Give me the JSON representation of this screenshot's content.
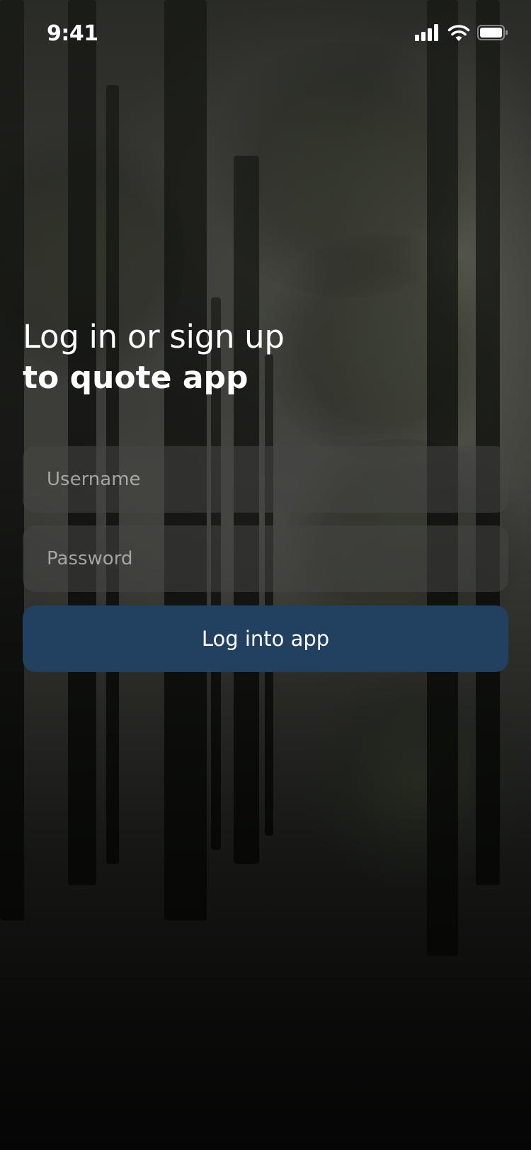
{
  "status_bar": {
    "time": "9:41",
    "icons": [
      "cellular-signal-icon",
      "wifi-icon",
      "battery-icon"
    ]
  },
  "login": {
    "heading_line1": "Log in or sign up",
    "heading_line2": "to quote app",
    "username_placeholder": "Username",
    "password_placeholder": "Password",
    "submit_label": "Log into app"
  },
  "colors": {
    "button_background": "#22405f",
    "text": "#ffffff"
  }
}
